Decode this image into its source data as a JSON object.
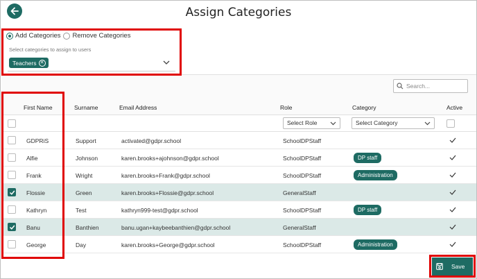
{
  "header": {
    "title": "Assign Categories"
  },
  "categories": {
    "mode_options": [
      {
        "label": "Add Categories",
        "selected": true
      },
      {
        "label": "Remove Categories",
        "selected": false
      }
    ],
    "hint": "Select categories to assign to users",
    "selected_chip": "Teachers"
  },
  "search": {
    "placeholder": "Search..."
  },
  "table": {
    "columns": [
      "First Name",
      "Surname",
      "Email Address",
      "Role",
      "Category",
      "Active"
    ],
    "filters": {
      "role": "Select Role",
      "category": "Select Category"
    },
    "rows": [
      {
        "first": "GDPRiS",
        "surname": "Support",
        "email": "activated@gdpr.school",
        "role": "SchoolDPStaff",
        "category": "",
        "checked": false,
        "active": true
      },
      {
        "first": "Alfie",
        "surname": "Johnson",
        "email": "karen.brooks+ajohnson@gdpr.school",
        "role": "SchoolDPStaff",
        "category": "DP staff",
        "checked": false,
        "active": true
      },
      {
        "first": "Frank",
        "surname": "Wright",
        "email": "karen.brooks+Frank@gdpr.school",
        "role": "SchoolDPStaff",
        "category": "Administration",
        "checked": false,
        "active": true
      },
      {
        "first": "Flossie",
        "surname": "Green",
        "email": "karen.brooks+Flossie@gdpr.school",
        "role": "GeneralStaff",
        "category": "",
        "checked": true,
        "active": true
      },
      {
        "first": "Kathryn",
        "surname": "Test",
        "email": "kathryn999-test@gdpr.school",
        "role": "SchoolDPStaff",
        "category": "DP staff",
        "checked": false,
        "active": true
      },
      {
        "first": "Banu",
        "surname": "Banthien",
        "email": "banu.ugan+kaybeebanthien@gdpr.school",
        "role": "GeneralStaff",
        "category": "",
        "checked": true,
        "active": true
      },
      {
        "first": "George",
        "surname": "Day",
        "email": "karen.brooks+George@gdpr.school",
        "role": "SchoolDPStaff",
        "category": "Administration",
        "checked": false,
        "active": true
      }
    ]
  },
  "footer": {
    "save_label": "Save"
  },
  "colors": {
    "accent": "#1e6b63",
    "highlight": "#e00000",
    "selected_row": "#dbe9e7"
  },
  "icons": [
    "back-arrow-icon",
    "chevron-down-icon",
    "close-circle-icon",
    "search-icon",
    "checkmark-icon",
    "save-disk-icon"
  ]
}
